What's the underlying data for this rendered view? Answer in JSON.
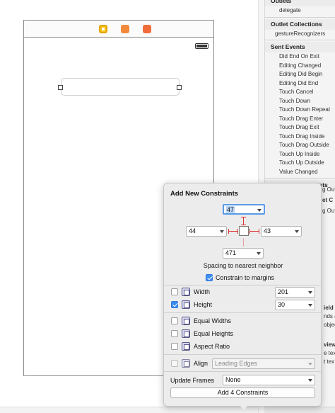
{
  "connections_panel": {
    "outlets_heading": "Outlets",
    "outlets": [
      "delegate"
    ],
    "outlet_collections_heading": "Outlet Collections",
    "outlet_collections": [
      "gestureRecognizers"
    ],
    "sent_events_heading": "Sent Events",
    "sent_events": [
      "Did End On Exit",
      "Editing Changed",
      "Editing Did Begin",
      "Editing Did End",
      "Touch Cancel",
      "Touch Down",
      "Touch Down Repeat",
      "Touch Drag Enter",
      "Touch Drag Exit",
      "Touch Drag Inside",
      "Touch Drag Outside",
      "Touch Up Inside",
      "Touch Up Outside",
      "Value Changed"
    ],
    "referencing_outlets_heading": "Referencing Outlets",
    "peek_texts": [
      "g Out",
      "et C",
      "g Out",
      "ield",
      "nds a",
      "objec",
      "view",
      "e tex",
      "t tex"
    ]
  },
  "constraints_popover": {
    "title": "Add New Constraints",
    "top_value": "47",
    "left_value": "44",
    "right_value": "43",
    "bottom_value": "471",
    "spacing_label": "Spacing to nearest neighbor",
    "constrain_margins_label": "Constrain to margins",
    "constrain_margins_checked": true,
    "width_label": "Width",
    "width_value": "201",
    "width_checked": false,
    "height_label": "Height",
    "height_value": "30",
    "height_checked": true,
    "equal_widths_label": "Equal Widths",
    "equal_heights_label": "Equal Heights",
    "aspect_ratio_label": "Aspect Ratio",
    "align_label": "Align",
    "align_value": "Leading Edges",
    "update_frames_label": "Update Frames",
    "update_frames_value": "None",
    "add_button_label": "Add 4 Constraints"
  },
  "colors": {
    "accent_blue": "#3b8cf5",
    "pin_red": "#dd3333",
    "popover_bg": "#ececec"
  },
  "icons": [
    "view-controller-icon",
    "first-responder-icon",
    "exit-icon",
    "battery-icon",
    "checkbox-icon",
    "constraint-option-icon"
  ]
}
